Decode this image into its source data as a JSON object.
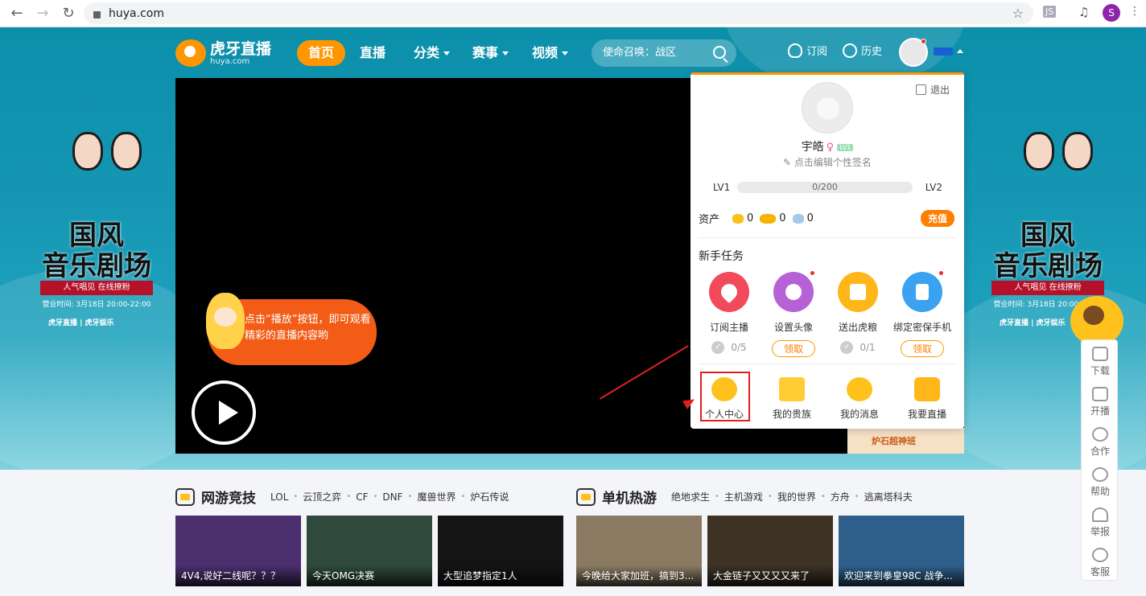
{
  "browser": {
    "url": "huya.com",
    "ext_js": "JS",
    "profile_initial": "S"
  },
  "site": {
    "logo_cn": "虎牙直播",
    "logo_en": "huya.com",
    "nav": [
      {
        "label": "首页",
        "active": true
      },
      {
        "label": "直播"
      },
      {
        "label": "分类"
      },
      {
        "label": "赛事"
      },
      {
        "label": "视频"
      }
    ],
    "search_placeholder": "使命召唤：战区",
    "subscribe_label": "订阅",
    "history_label": "历史"
  },
  "poster": {
    "title_line1": "国风",
    "title_line2": "音乐剧场",
    "ribbon": "人气唱见 在线撩粉",
    "time": "营业时间: 3月18日 20:00-22:00",
    "brand": "虎牙直播 | 虎牙娱乐"
  },
  "player": {
    "tip_text": "点击“播放”按钮，即可观看精彩的直播内容哟",
    "behind_text": "炉石超神班"
  },
  "user_panel": {
    "logout_label": "退出",
    "username": "宇皓",
    "sex_symbol": "♀",
    "level_tag": "LV1",
    "signature": "点击编辑个性签名",
    "level_current": "LV1",
    "level_next": "LV2",
    "exp_text": "0/200",
    "assets_label": "资产",
    "assets": [
      {
        "icon": "gold-bean-icon",
        "value": "0",
        "color": "#f7c21b"
      },
      {
        "icon": "gold-ticket-icon",
        "value": "0",
        "color": "#f5b300"
      },
      {
        "icon": "silver-bean-icon",
        "value": "0",
        "color": "#a8c8e8"
      }
    ],
    "recharge_label": "充值",
    "tasks_title": "新手任务",
    "tasks": [
      {
        "label": "订阅主播",
        "color": "#f24a5a",
        "progress": "0/5",
        "claimable": false,
        "dot": false
      },
      {
        "label": "设置头像",
        "color": "#b661d6",
        "action": "领取",
        "claimable": true,
        "dot": true
      },
      {
        "label": "送出虎粮",
        "color": "#ffb619",
        "progress": "0/1",
        "claimable": false,
        "dot": false
      },
      {
        "label": "绑定密保手机",
        "color": "#3aa2f0",
        "action": "领取",
        "claimable": true,
        "dot": true
      }
    ],
    "bottom_links": [
      {
        "label": "个人中心",
        "color": "#ffc21c"
      },
      {
        "label": "我的贵族",
        "color": "#ffcc33"
      },
      {
        "label": "我的消息",
        "color": "#ffc21c"
      },
      {
        "label": "我要直播",
        "color": "#ffb619"
      }
    ]
  },
  "right_sidebar": [
    "下载",
    "开播",
    "合作",
    "帮助",
    "举报",
    "客服"
  ],
  "sections": [
    {
      "title": "网游竞技",
      "tags": [
        "LOL",
        "云顶之弈",
        "CF",
        "DNF",
        "魔兽世界",
        "炉石传说"
      ]
    },
    {
      "title": "单机热游",
      "tags": [
        "绝地求生",
        "主机游戏",
        "我的世界",
        "方舟",
        "逃离塔科夫"
      ]
    }
  ],
  "thumbnails": [
    {
      "caption": "4V4,说好二线呢？？？",
      "bg": "#4b2f6e"
    },
    {
      "caption": "今天OMG决赛",
      "bg": "#2f4a3c"
    },
    {
      "caption": "大型追梦指定1人",
      "bg": "#141414"
    },
    {
      "caption": "今晚给大家加班，搞到3...",
      "bg": "#8a7a62"
    },
    {
      "caption": "大金链子又又又又来了",
      "bg": "#3d3224"
    },
    {
      "caption": "欢迎来到拳皇98C 战争...",
      "bg": "#2d5f8a"
    }
  ]
}
